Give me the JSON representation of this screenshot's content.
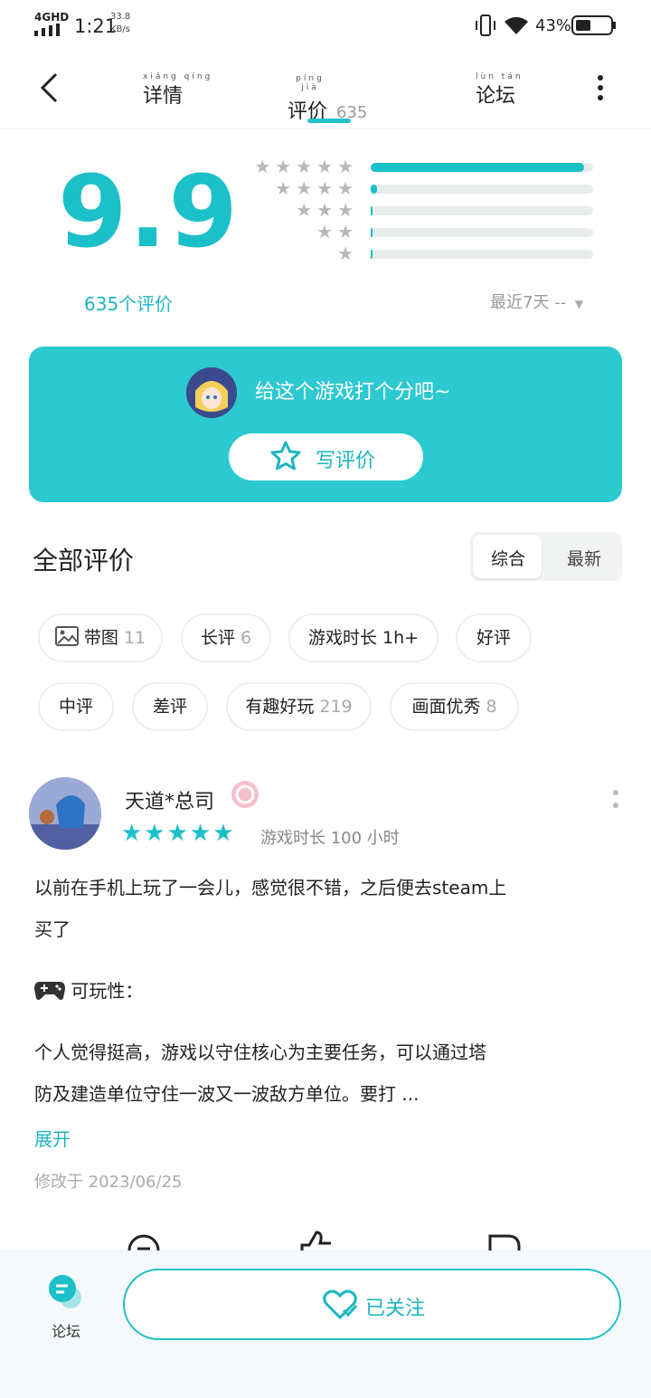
{
  "status_bar": {
    "network": "4GHD",
    "time": "1:21",
    "speed_value": "33.8",
    "speed_unit": "KB/s",
    "battery": "43%"
  },
  "nav": {
    "tabs": [
      {
        "pinyin": "xiáng qíng",
        "label": "详情"
      },
      {
        "pinyin": "píng jià",
        "label": "评价",
        "count": "635"
      },
      {
        "pinyin": "lùn tán",
        "label": "论坛"
      }
    ]
  },
  "rating": {
    "score": "9.9",
    "count_label": "635个评价",
    "distribution": [
      0.96,
      0.03,
      0.01,
      0.01,
      0.01
    ],
    "filter": "最近7天 --"
  },
  "banner": {
    "prompt": "给这个游戏打个分吧~",
    "write_label": "写评价"
  },
  "reviews": {
    "title": "全部评价",
    "sort": [
      "综合",
      "最新"
    ],
    "chips": [
      {
        "label": "带图",
        "count": "11"
      },
      {
        "label": "长评",
        "count": "6"
      },
      {
        "label": "游戏时长 1h+",
        "count": ""
      },
      {
        "label": "好评",
        "count": ""
      },
      {
        "label": "中评",
        "count": ""
      },
      {
        "label": "差评",
        "count": ""
      },
      {
        "label": "有趣好玩",
        "count": "219"
      },
      {
        "label": "画面优秀",
        "count": "8"
      }
    ]
  },
  "review": {
    "user": "天道*总司",
    "stars": 5,
    "play_time": "游戏时长 100 小时",
    "line1": "以前在手机上玩了一会儿，感觉很不错，之后便去steam上",
    "line2": "买了",
    "section": "可玩性：",
    "line3": "个人觉得挺高，游戏以守住核心为主要任务，可以通过塔",
    "line4": "防及建造单位守住一波又一波敌方单位。要打 ...",
    "expand": "展开",
    "edited": "修改于 2023/06/25"
  },
  "bottom": {
    "forum_label": "论坛",
    "follow_label": "已关注"
  },
  "colors": {
    "accent": "#1cc0c8",
    "banner": "#2dc9d0"
  }
}
